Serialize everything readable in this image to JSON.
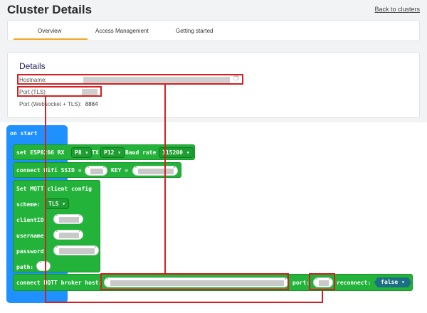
{
  "header": {
    "title": "Cluster Details",
    "back_link": "Back to clusters"
  },
  "tabs": [
    {
      "label": "Overview",
      "active": true
    },
    {
      "label": "Access Management",
      "active": false
    },
    {
      "label": "Getting started",
      "active": false
    }
  ],
  "details": {
    "title": "Details",
    "hostname_label": "Hostname:",
    "port_tls_label": "Port (TLS)",
    "port_ws_label": "Port (Websocket + TLS):",
    "port_ws_value": "8884"
  },
  "blocks": {
    "on_start": "on start",
    "esp": {
      "set_label": "set ESP8266 RX",
      "rx": "P8 ▾",
      "tx_label": "TX",
      "tx": "P12 ▾",
      "baud_label": "Baud rate",
      "baud": "115200 ▾"
    },
    "wifi": {
      "label": "connect Wifi SSID =",
      "key_label": "KEY ="
    },
    "mqtt": {
      "title": "Set MQTT client config",
      "scheme_label": "scheme:",
      "scheme_value": "TLS ▾",
      "client_label": "clientID:",
      "username_label": "username:",
      "password_label": "password:",
      "path_label": "path:"
    },
    "broker": {
      "label": "connect MQTT broker host:",
      "port_label": "port:",
      "reconnect_label": "reconnect:",
      "reconnect_value": "false ▾"
    }
  },
  "colors": {
    "accent": "#f5a623",
    "block_green": "#23b33a",
    "block_blue": "#1e90ff",
    "highlight": "#d42020",
    "hex_block": "#1d6f86"
  }
}
